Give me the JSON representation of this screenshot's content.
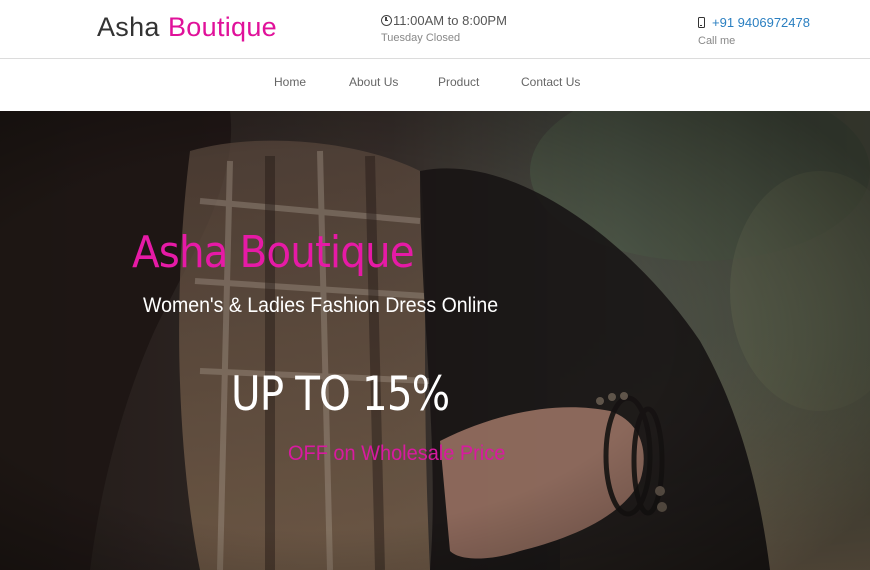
{
  "header": {
    "logo_part1": "Asha",
    "logo_part2": "Boutique",
    "hours_text": "11:00AM to 8:00PM",
    "hours_note": "Tuesday Closed",
    "phone_text": "+91 9406972478",
    "phone_note": "Call me",
    "icons": [
      "clock-icon",
      "mobile-phone-icon"
    ]
  },
  "nav": {
    "items": [
      {
        "label": "Home"
      },
      {
        "label": "About Us"
      },
      {
        "label": "Product"
      },
      {
        "label": "Contact Us"
      }
    ]
  },
  "hero": {
    "title": "Asha Boutique",
    "subtitle": "Women's & Ladies Fashion Dress Online",
    "offer": "UP TO 15%",
    "offer_note": "OFF on Wholesale Price"
  },
  "colors": {
    "brand_pink": "#e0119a",
    "link_blue": "#2a7fc1",
    "nav_text": "#666666"
  }
}
